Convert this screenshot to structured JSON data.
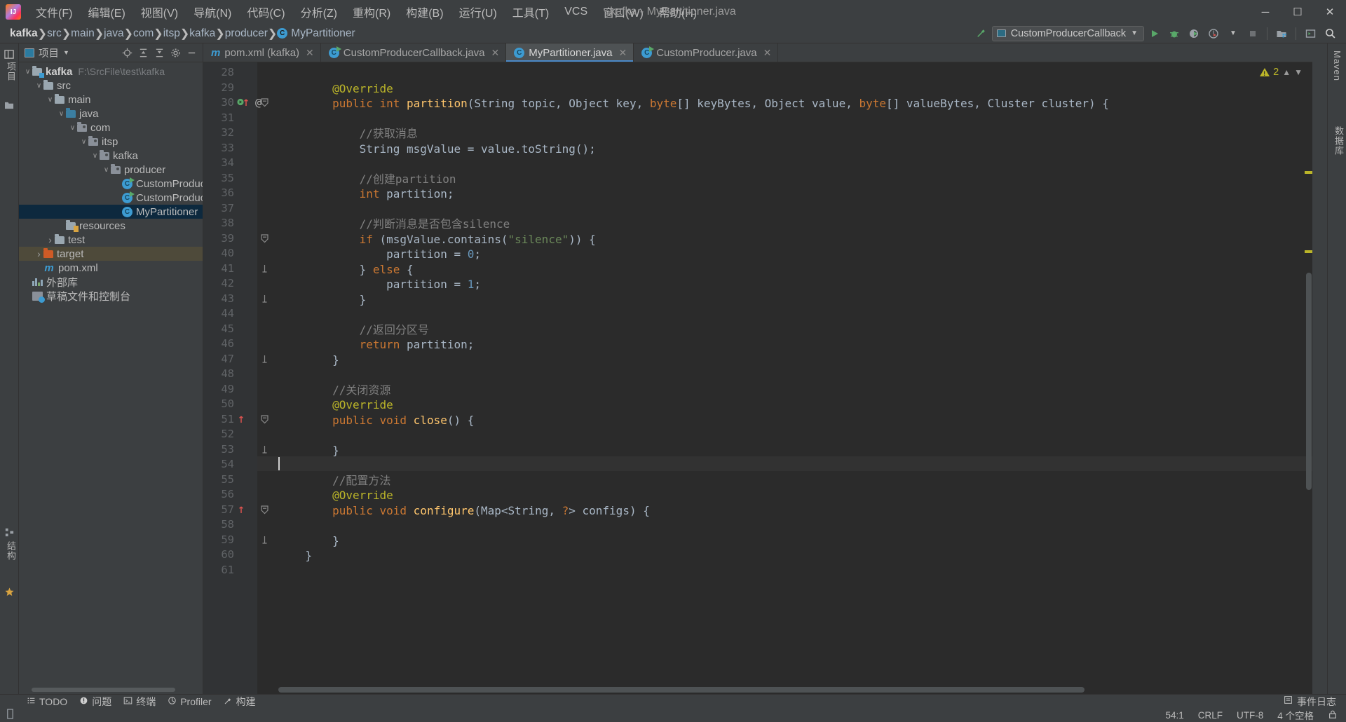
{
  "window": {
    "title": "kafka - MyPartitioner.java",
    "controls": [
      "minimize",
      "maximize",
      "close"
    ]
  },
  "menu": {
    "items": [
      {
        "label": "文件(F)"
      },
      {
        "label": "编辑(E)"
      },
      {
        "label": "视图(V)"
      },
      {
        "label": "导航(N)"
      },
      {
        "label": "代码(C)"
      },
      {
        "label": "分析(Z)"
      },
      {
        "label": "重构(R)"
      },
      {
        "label": "构建(B)"
      },
      {
        "label": "运行(U)"
      },
      {
        "label": "工具(T)"
      },
      {
        "label": "VCS"
      },
      {
        "label": "窗口(W)"
      },
      {
        "label": "帮助(H)"
      }
    ]
  },
  "navbar": {
    "breadcrumbs": [
      {
        "label": "kafka",
        "icon": "module-icon"
      },
      {
        "label": "src",
        "icon": "folder-icon"
      },
      {
        "label": "main",
        "icon": "folder-icon"
      },
      {
        "label": "java",
        "icon": "folder-icon"
      },
      {
        "label": "com",
        "icon": "package-icon"
      },
      {
        "label": "itsp",
        "icon": "package-icon"
      },
      {
        "label": "kafka",
        "icon": "package-icon"
      },
      {
        "label": "producer",
        "icon": "package-icon"
      },
      {
        "label": "MyPartitioner",
        "icon": "class-icon"
      }
    ],
    "run_config": "CustomProducerCallback",
    "buttons": [
      "build-hammer-icon",
      "run-icon",
      "debug-icon",
      "run-coverage-icon",
      "profiler-icon",
      "stop-icon",
      "select-opened-file-icon",
      "open-terminal-icon",
      "search-everywhere-icon"
    ]
  },
  "left_strip": {
    "items": [
      {
        "label": "项目",
        "name": "project-tool-window-button"
      },
      {
        "label": "结构",
        "name": "structure-tool-window-button"
      },
      {
        "label": "收藏夹",
        "name": "favorites-tool-window-button"
      }
    ]
  },
  "right_strip": {
    "items": [
      {
        "label": "Maven",
        "name": "maven-tool-window-button"
      },
      {
        "label": "数据库",
        "name": "database-tool-window-button"
      }
    ]
  },
  "project_panel": {
    "title": "项目",
    "actions": [
      "locate-icon",
      "expand-all-icon",
      "collapse-all-icon",
      "settings-gear-icon",
      "hide-icon"
    ],
    "tree": [
      {
        "indent": 0,
        "arrow": "down",
        "icon": "module-folder",
        "label": "kafka",
        "bold": true,
        "path": "F:\\SrcFile\\test\\kafka"
      },
      {
        "indent": 1,
        "arrow": "down",
        "icon": "folder",
        "label": "src"
      },
      {
        "indent": 2,
        "arrow": "down",
        "icon": "folder",
        "label": "main"
      },
      {
        "indent": 3,
        "arrow": "down",
        "icon": "source-folder",
        "label": "java"
      },
      {
        "indent": 4,
        "arrow": "down",
        "icon": "package",
        "label": "com"
      },
      {
        "indent": 5,
        "arrow": "down",
        "icon": "package",
        "label": "itsp"
      },
      {
        "indent": 6,
        "arrow": "down",
        "icon": "package",
        "label": "kafka"
      },
      {
        "indent": 7,
        "arrow": "down",
        "icon": "package",
        "label": "producer"
      },
      {
        "indent": 8,
        "arrow": "none",
        "icon": "class-runnable",
        "label": "CustomProducer"
      },
      {
        "indent": 8,
        "arrow": "none",
        "icon": "class-runnable",
        "label": "CustomProducer"
      },
      {
        "indent": 8,
        "arrow": "none",
        "icon": "class",
        "label": "MyPartitioner",
        "selected": true
      },
      {
        "indent": 3,
        "arrow": "none",
        "icon": "resource-folder",
        "label": "resources"
      },
      {
        "indent": 2,
        "arrow": "right",
        "icon": "folder",
        "label": "test"
      },
      {
        "indent": 1,
        "arrow": "right",
        "icon": "excluded-folder",
        "label": "target",
        "highlighted": true
      },
      {
        "indent": 1,
        "arrow": "none",
        "icon": "maven",
        "label": "pom.xml"
      },
      {
        "indent": 0,
        "arrow": "none",
        "icon": "library",
        "label": "外部库"
      },
      {
        "indent": 0,
        "arrow": "none",
        "icon": "scratch",
        "label": "草稿文件和控制台"
      }
    ]
  },
  "tabs": [
    {
      "label": "pom.xml (kafka)",
      "icon": "maven-icon",
      "active": false
    },
    {
      "label": "CustomProducerCallback.java",
      "icon": "class-runnable-icon",
      "active": false
    },
    {
      "label": "MyPartitioner.java",
      "icon": "class-icon",
      "active": true
    },
    {
      "label": "CustomProducer.java",
      "icon": "class-runnable-icon",
      "active": false
    }
  ],
  "editor": {
    "warning_count": "2",
    "first_line_number": 28,
    "caret_line_number": 54,
    "lines": [
      {
        "n": 28,
        "tokens": []
      },
      {
        "n": 29,
        "tokens": [
          {
            "t": "        ",
            "c": "txt"
          },
          {
            "t": "@Override",
            "c": "ann"
          }
        ]
      },
      {
        "n": 30,
        "gutter": "run-override",
        "fold": true,
        "tokens": [
          {
            "t": "        ",
            "c": "txt"
          },
          {
            "t": "public",
            "c": "kw"
          },
          {
            "t": " ",
            "c": "txt"
          },
          {
            "t": "int",
            "c": "kw"
          },
          {
            "t": " ",
            "c": "txt"
          },
          {
            "t": "partition",
            "c": "mth"
          },
          {
            "t": "(String topic, Object key, ",
            "c": "txt"
          },
          {
            "t": "byte",
            "c": "kw"
          },
          {
            "t": "[] keyBytes, Object value, ",
            "c": "txt"
          },
          {
            "t": "byte",
            "c": "kw"
          },
          {
            "t": "[] valueBytes, Cluster cluster) {",
            "c": "txt"
          }
        ]
      },
      {
        "n": 31,
        "tokens": []
      },
      {
        "n": 32,
        "tokens": [
          {
            "t": "            ",
            "c": "txt"
          },
          {
            "t": "//获取消息",
            "c": "cmt"
          }
        ]
      },
      {
        "n": 33,
        "tokens": [
          {
            "t": "            String msgValue = value.toString();",
            "c": "txt"
          }
        ]
      },
      {
        "n": 34,
        "tokens": []
      },
      {
        "n": 35,
        "tokens": [
          {
            "t": "            ",
            "c": "txt"
          },
          {
            "t": "//创建partition",
            "c": "cmt"
          }
        ]
      },
      {
        "n": 36,
        "tokens": [
          {
            "t": "            ",
            "c": "txt"
          },
          {
            "t": "int",
            "c": "kw"
          },
          {
            "t": " partition;",
            "c": "txt"
          }
        ]
      },
      {
        "n": 37,
        "tokens": []
      },
      {
        "n": 38,
        "tokens": [
          {
            "t": "            ",
            "c": "txt"
          },
          {
            "t": "//判断消息是否包含silence",
            "c": "cmt"
          }
        ]
      },
      {
        "n": 39,
        "fold": true,
        "tokens": [
          {
            "t": "            ",
            "c": "txt"
          },
          {
            "t": "if",
            "c": "kw"
          },
          {
            "t": " (msgValue.contains(",
            "c": "txt"
          },
          {
            "t": "\"silence\"",
            "c": "str"
          },
          {
            "t": ")) {",
            "c": "txt"
          }
        ]
      },
      {
        "n": 40,
        "tokens": [
          {
            "t": "                partition = ",
            "c": "txt"
          },
          {
            "t": "0",
            "c": "num"
          },
          {
            "t": ";",
            "c": "txt"
          }
        ]
      },
      {
        "n": 41,
        "fold": "end",
        "tokens": [
          {
            "t": "            } ",
            "c": "txt"
          },
          {
            "t": "else",
            "c": "kw"
          },
          {
            "t": " {",
            "c": "txt"
          }
        ]
      },
      {
        "n": 42,
        "tokens": [
          {
            "t": "                partition = ",
            "c": "txt"
          },
          {
            "t": "1",
            "c": "num"
          },
          {
            "t": ";",
            "c": "txt"
          }
        ]
      },
      {
        "n": 43,
        "fold": "end",
        "tokens": [
          {
            "t": "            }",
            "c": "txt"
          }
        ]
      },
      {
        "n": 44,
        "tokens": []
      },
      {
        "n": 45,
        "tokens": [
          {
            "t": "            ",
            "c": "txt"
          },
          {
            "t": "//返回分区号",
            "c": "cmt"
          }
        ]
      },
      {
        "n": 46,
        "tokens": [
          {
            "t": "            ",
            "c": "txt"
          },
          {
            "t": "return",
            "c": "kw"
          },
          {
            "t": " partition;",
            "c": "txt"
          }
        ]
      },
      {
        "n": 47,
        "fold": "end",
        "tokens": [
          {
            "t": "        }",
            "c": "txt"
          }
        ]
      },
      {
        "n": 48,
        "tokens": []
      },
      {
        "n": 49,
        "tokens": [
          {
            "t": "        ",
            "c": "txt"
          },
          {
            "t": "//关闭资源",
            "c": "cmt"
          }
        ]
      },
      {
        "n": 50,
        "tokens": [
          {
            "t": "        ",
            "c": "txt"
          },
          {
            "t": "@Override",
            "c": "ann"
          }
        ]
      },
      {
        "n": 51,
        "gutter": "override",
        "fold": true,
        "tokens": [
          {
            "t": "        ",
            "c": "txt"
          },
          {
            "t": "public",
            "c": "kw"
          },
          {
            "t": " ",
            "c": "txt"
          },
          {
            "t": "void",
            "c": "kw"
          },
          {
            "t": " ",
            "c": "txt"
          },
          {
            "t": "close",
            "c": "mth"
          },
          {
            "t": "() {",
            "c": "txt"
          }
        ]
      },
      {
        "n": 52,
        "tokens": []
      },
      {
        "n": 53,
        "fold": "end",
        "tokens": [
          {
            "t": "        }",
            "c": "txt"
          }
        ]
      },
      {
        "n": 54,
        "caret": true,
        "tokens": []
      },
      {
        "n": 55,
        "tokens": [
          {
            "t": "        ",
            "c": "txt"
          },
          {
            "t": "//配置方法",
            "c": "cmt"
          }
        ]
      },
      {
        "n": 56,
        "tokens": [
          {
            "t": "        ",
            "c": "txt"
          },
          {
            "t": "@Override",
            "c": "ann"
          }
        ]
      },
      {
        "n": 57,
        "gutter": "override",
        "fold": true,
        "tokens": [
          {
            "t": "        ",
            "c": "txt"
          },
          {
            "t": "public",
            "c": "kw"
          },
          {
            "t": " ",
            "c": "txt"
          },
          {
            "t": "void",
            "c": "kw"
          },
          {
            "t": " ",
            "c": "txt"
          },
          {
            "t": "configure",
            "c": "mth"
          },
          {
            "t": "(Map<String, ",
            "c": "txt"
          },
          {
            "t": "?",
            "c": "kw"
          },
          {
            "t": "> configs) {",
            "c": "txt"
          }
        ]
      },
      {
        "n": 58,
        "tokens": []
      },
      {
        "n": 59,
        "fold": "end",
        "tokens": [
          {
            "t": "        }",
            "c": "txt"
          }
        ]
      },
      {
        "n": 60,
        "tokens": [
          {
            "t": "    }",
            "c": "txt"
          }
        ]
      },
      {
        "n": 61,
        "tokens": []
      }
    ]
  },
  "bottom_bar": {
    "items": [
      {
        "label": "TODO",
        "icon": "todo-icon"
      },
      {
        "label": "问题",
        "icon": "problems-icon"
      },
      {
        "label": "终端",
        "icon": "terminal-icon"
      },
      {
        "label": "Profiler",
        "icon": "profiler-icon"
      },
      {
        "label": "构建",
        "icon": "build-hammer-icon"
      }
    ],
    "event_log": "事件日志"
  },
  "status_bar": {
    "caret_position": "54:1",
    "line_separator": "CRLF",
    "encoding": "UTF-8",
    "indent": "4 个空格",
    "lock_icon": "read-write-icon"
  },
  "colors": {
    "background": "#3c3f41",
    "editor_bg": "#2b2b2b",
    "accent": "#4a88c7",
    "selection": "#0d293e",
    "keyword": "#cc7832",
    "string": "#6a8759",
    "number": "#6897bb",
    "comment": "#808080",
    "annotation": "#bbb529",
    "method": "#ffc66d"
  }
}
